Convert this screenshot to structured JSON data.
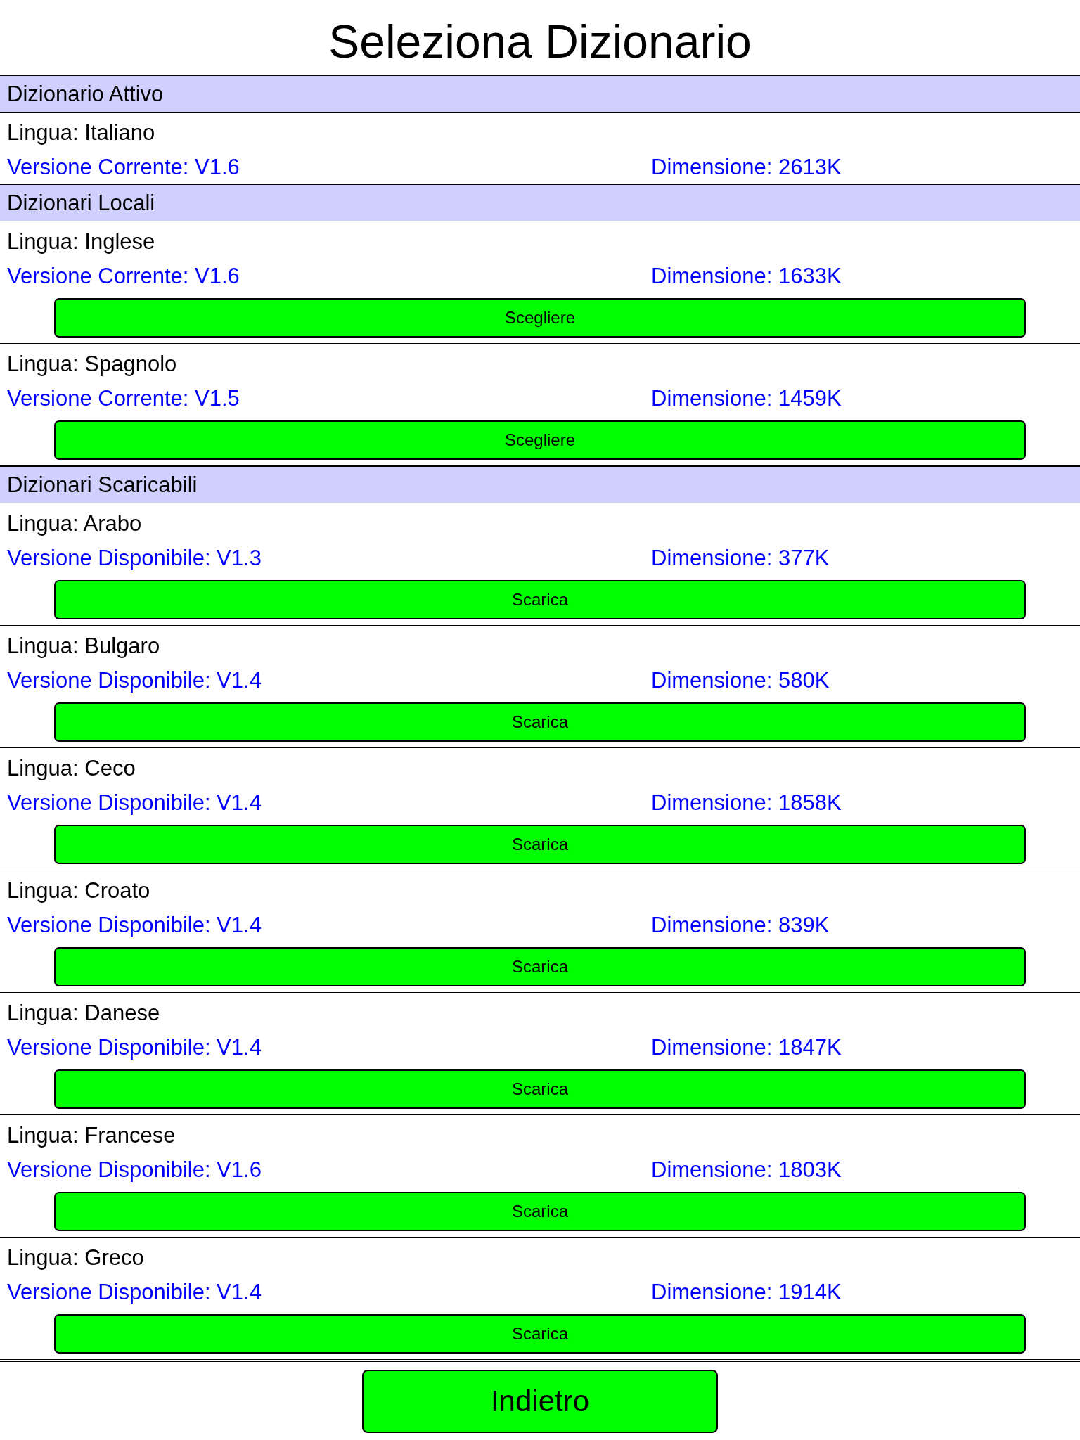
{
  "title": "Seleziona Dizionario",
  "sections": [
    {
      "title": "Dizionario Attivo",
      "items": [
        {
          "language": "Lingua: Italiano",
          "version": "Versione Corrente: V1.6",
          "size": "Dimensione: 2613K"
        }
      ]
    },
    {
      "title": "Dizionari Locali",
      "items": [
        {
          "language": "Lingua: Inglese",
          "version": "Versione Corrente: V1.6",
          "size": "Dimensione: 1633K",
          "button": "Scegliere"
        },
        {
          "language": "Lingua: Spagnolo",
          "version": "Versione Corrente: V1.5",
          "size": "Dimensione: 1459K",
          "button": "Scegliere"
        }
      ]
    },
    {
      "title": "Dizionari Scaricabili",
      "items": [
        {
          "language": "Lingua: Arabo",
          "version": "Versione Disponibile: V1.3",
          "size": "Dimensione: 377K",
          "button": "Scarica"
        },
        {
          "language": "Lingua: Bulgaro",
          "version": "Versione Disponibile: V1.4",
          "size": "Dimensione: 580K",
          "button": "Scarica"
        },
        {
          "language": "Lingua: Ceco",
          "version": "Versione Disponibile: V1.4",
          "size": "Dimensione: 1858K",
          "button": "Scarica"
        },
        {
          "language": "Lingua: Croato",
          "version": "Versione Disponibile: V1.4",
          "size": "Dimensione: 839K",
          "button": "Scarica"
        },
        {
          "language": "Lingua: Danese",
          "version": "Versione Disponibile: V1.4",
          "size": "Dimensione: 1847K",
          "button": "Scarica"
        },
        {
          "language": "Lingua: Francese",
          "version": "Versione Disponibile: V1.6",
          "size": "Dimensione: 1803K",
          "button": "Scarica"
        },
        {
          "language": "Lingua: Greco",
          "version": "Versione Disponibile: V1.4",
          "size": "Dimensione: 1914K",
          "button": "Scarica"
        }
      ]
    }
  ],
  "back_button": "Indietro"
}
